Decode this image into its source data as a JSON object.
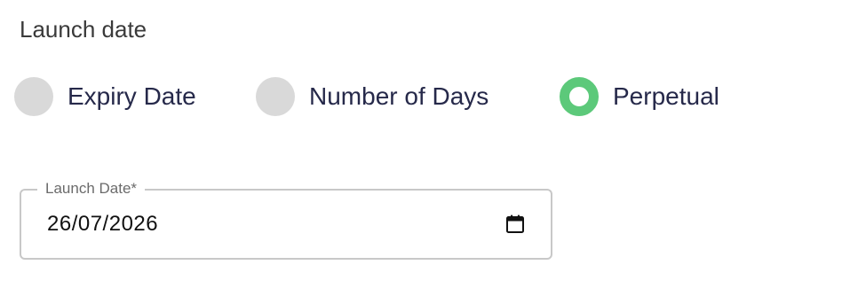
{
  "section": {
    "title": "Launch date"
  },
  "radio_options": [
    {
      "label": "Expiry Date",
      "selected": false
    },
    {
      "label": "Number of Days",
      "selected": false
    },
    {
      "label": "Perpetual",
      "selected": true
    }
  ],
  "launch_date_field": {
    "label": "Launch Date*",
    "value": "26/07/2026",
    "icon": "calendar-icon"
  },
  "colors": {
    "radio_selected": "#5cc97a",
    "radio_unselected": "#d9d9d9",
    "field_border": "#c8c8c8"
  }
}
